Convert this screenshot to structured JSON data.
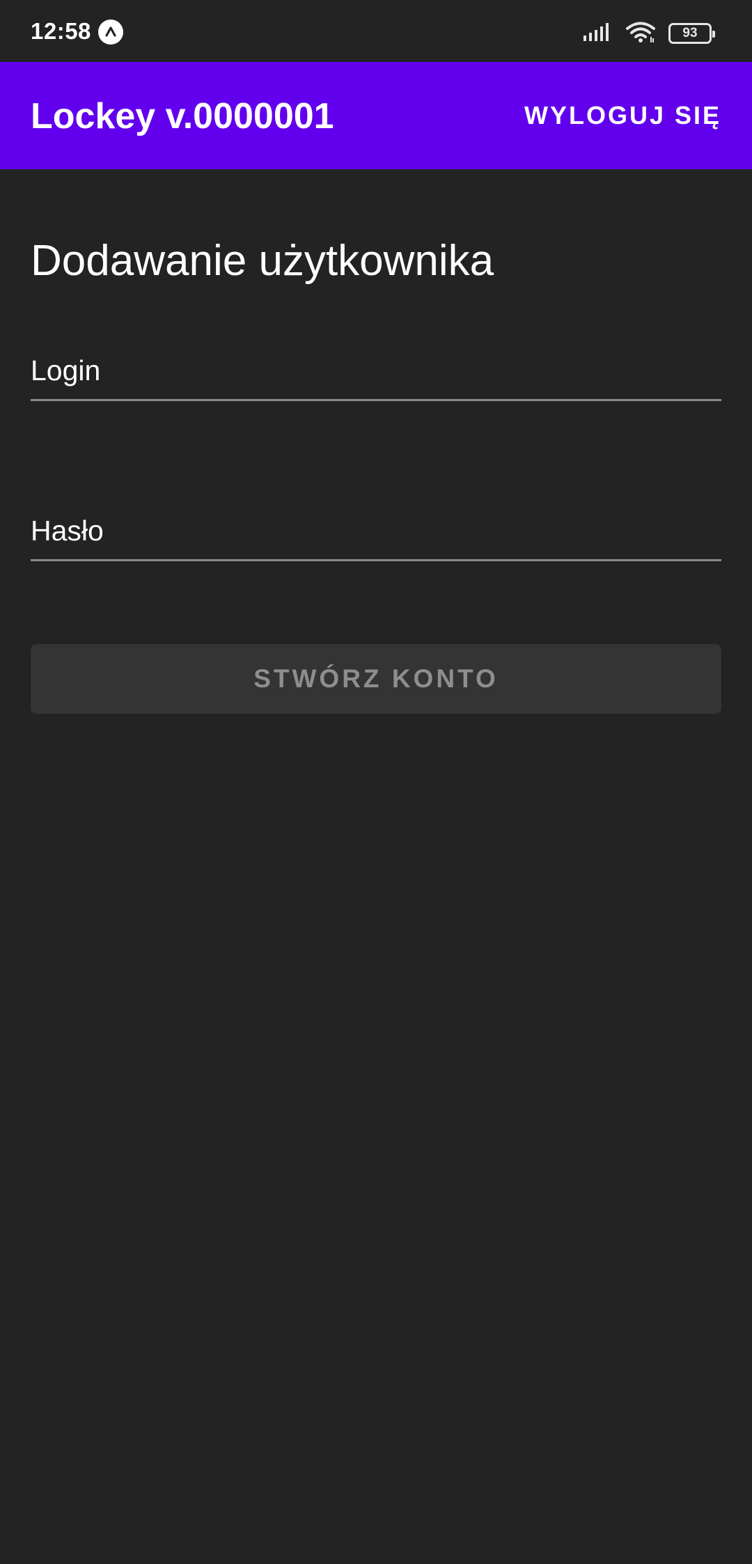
{
  "status_bar": {
    "time": "12:58",
    "app_icon": "app-a-icon",
    "signal_icon": "cell-signal-icon",
    "wifi_icon": "wifi-icon",
    "battery_level": "93"
  },
  "app_bar": {
    "title": "Lockey v.0000001",
    "logout_label": "WYLOGUJ SIĘ",
    "background_color": "#6200ee"
  },
  "form": {
    "title": "Dodawanie użytkownika",
    "login_placeholder": "Login",
    "login_value": "",
    "password_placeholder": "Hasło",
    "password_value": "",
    "submit_label": "STWÓRZ KONTO"
  }
}
